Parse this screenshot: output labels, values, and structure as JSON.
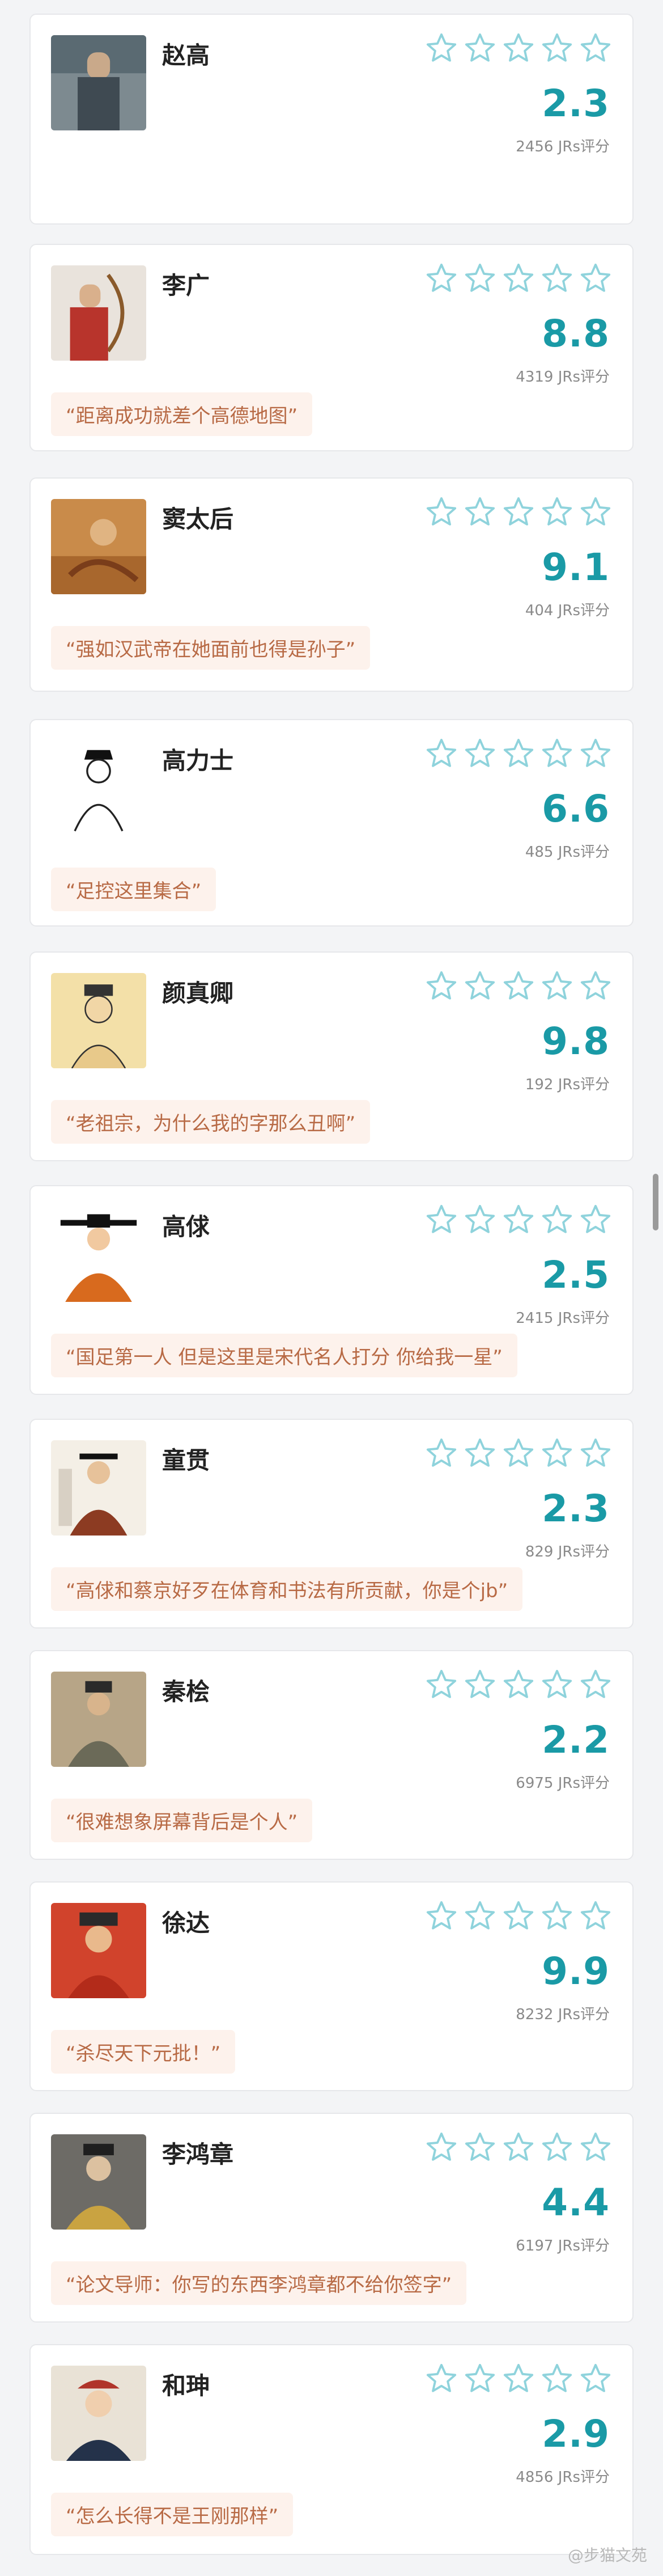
{
  "colors": {
    "accent": "#1a9aa6",
    "star_outline": "#8fd3dc",
    "quote_bg": "#fdf2ec",
    "quote_text": "#b86a45"
  },
  "watermark": "@步猫文苑",
  "cards": [
    {
      "name": "赵高",
      "score": "2.3",
      "count": "2456 JRs评分",
      "quote": "",
      "stars": 5
    },
    {
      "name": "李广",
      "score": "8.8",
      "count": "4319 JRs评分",
      "quote": "“距离成功就差个高德地图”",
      "stars": 5
    },
    {
      "name": "窦太后",
      "score": "9.1",
      "count": "404 JRs评分",
      "quote": "“强如汉武帝在她面前也得是孙子”",
      "stars": 5
    },
    {
      "name": "高力士",
      "score": "6.6",
      "count": "485 JRs评分",
      "quote": "“足控这里集合”",
      "stars": 5
    },
    {
      "name": "颜真卿",
      "score": "9.8",
      "count": "192 JRs评分",
      "quote": "“老祖宗，为什么我的字那么丑啊”",
      "stars": 5
    },
    {
      "name": "高俅",
      "score": "2.5",
      "count": "2415 JRs评分",
      "quote": "“国足第一人 但是这里是宋代名人打分 你给我一星”",
      "stars": 5
    },
    {
      "name": "童贯",
      "score": "2.3",
      "count": "829 JRs评分",
      "quote": "“高俅和蔡京好歹在体育和书法有所贡献，你是个jb”",
      "stars": 5
    },
    {
      "name": "秦桧",
      "score": "2.2",
      "count": "6975 JRs评分",
      "quote": "“很难想象屏幕背后是个人”",
      "stars": 5
    },
    {
      "name": "徐达",
      "score": "9.9",
      "count": "8232 JRs评分",
      "quote": "“杀尽天下元批！”",
      "stars": 5
    },
    {
      "name": "李鸿章",
      "score": "4.4",
      "count": "6197 JRs评分",
      "quote": "“论文导师：你写的东西李鸿章都不给你签字”",
      "stars": 5
    },
    {
      "name": "和珅",
      "score": "2.9",
      "count": "4856 JRs评分",
      "quote": "“怎么长得不是王刚那样”",
      "stars": 5
    }
  ]
}
